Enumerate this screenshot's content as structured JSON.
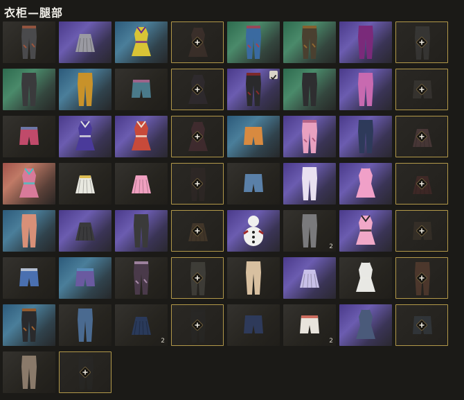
{
  "title": "衣柜—腿部",
  "slots": [
    {
      "bg": "dark",
      "kind": "pants",
      "color": "#4a4a4c",
      "accent": "#b0583a"
    },
    {
      "bg": "purple",
      "kind": "skirt",
      "color": "#9a9aa2"
    },
    {
      "bg": "blue",
      "kind": "outfit",
      "color": "#d8c436",
      "accent": "#6a2a8a"
    },
    {
      "bg": "locked",
      "kind": "outfit",
      "color": "#5a3a30",
      "locked": true
    },
    {
      "bg": "green",
      "kind": "pants",
      "color": "#3a6aa0",
      "accent": "#c03a3a"
    },
    {
      "bg": "green",
      "kind": "pants",
      "color": "#4a4030",
      "accent": "#a07030"
    },
    {
      "bg": "purple",
      "kind": "pants",
      "color": "#7a2a7a"
    },
    {
      "bg": "locked",
      "kind": "pants",
      "color": "#4a4a4a",
      "locked": true
    },
    {
      "bg": "green",
      "kind": "pants",
      "color": "#3a3a3c"
    },
    {
      "bg": "blue",
      "kind": "pants",
      "color": "#c8922a"
    },
    {
      "bg": "dark",
      "kind": "shorts",
      "color": "#4a7a8a",
      "accent": "#c05a8a"
    },
    {
      "bg": "locked",
      "kind": "outfit",
      "color": "#3a3040",
      "locked": true
    },
    {
      "bg": "purple",
      "kind": "pants",
      "color": "#2a2a2c",
      "accent": "#a02a2a",
      "checked": true
    },
    {
      "bg": "green",
      "kind": "pants",
      "color": "#2e2e30"
    },
    {
      "bg": "purple",
      "kind": "pants",
      "color": "#c86ab0"
    },
    {
      "bg": "locked",
      "kind": "shorts",
      "color": "#4a4440",
      "locked": true
    },
    {
      "bg": "dark",
      "kind": "shorts",
      "color": "#c04a6a",
      "accent": "#4a8ac0"
    },
    {
      "bg": "purple",
      "kind": "outfit",
      "color": "#4a3a9a",
      "accent": "#e0e0e0"
    },
    {
      "bg": "purple",
      "kind": "outfit",
      "color": "#c84a3a",
      "accent": "#f0e0d0"
    },
    {
      "bg": "locked",
      "kind": "outfit",
      "color": "#6a3040",
      "locked": true
    },
    {
      "bg": "blue",
      "kind": "shorts",
      "color": "#d88a40"
    },
    {
      "bg": "purple",
      "kind": "pants",
      "color": "#e8a0c0",
      "accent": "#a04a70"
    },
    {
      "bg": "purple",
      "kind": "pants",
      "color": "#2e3a5a"
    },
    {
      "bg": "locked",
      "kind": "skirt",
      "color": "#7a4a50",
      "locked": true
    },
    {
      "bg": "red",
      "kind": "outfit",
      "color": "#d87a9a",
      "accent": "#4ac0c0"
    },
    {
      "bg": "dark",
      "kind": "skirt",
      "color": "#e8e8e0",
      "accent": "#d8b030"
    },
    {
      "bg": "dark",
      "kind": "skirt",
      "color": "#f0a0c0"
    },
    {
      "bg": "locked",
      "kind": "pants",
      "color": "#3a2a2a",
      "locked": true
    },
    {
      "bg": "dark",
      "kind": "shorts",
      "color": "#5a80a8"
    },
    {
      "bg": "purple",
      "kind": "pants",
      "color": "#e8e0f0"
    },
    {
      "bg": "purple",
      "kind": "outfit",
      "color": "#f0a0c8"
    },
    {
      "bg": "locked",
      "kind": "skirt",
      "color": "#6a2a2a",
      "locked": true
    },
    {
      "bg": "blue",
      "kind": "pants",
      "color": "#d89078"
    },
    {
      "bg": "purple",
      "kind": "skirt",
      "color": "#3a3a3c"
    },
    {
      "bg": "purple",
      "kind": "pants",
      "color": "#3a3a3a"
    },
    {
      "bg": "locked",
      "kind": "skirt",
      "color": "#6a4a2a",
      "locked": true
    },
    {
      "bg": "purple",
      "kind": "snowman",
      "color": "#f0f0ee",
      "accent": "#a02a2a"
    },
    {
      "bg": "dark",
      "kind": "pants",
      "color": "#7a7a7c",
      "count": "2"
    },
    {
      "bg": "purple",
      "kind": "outfit",
      "color": "#f0a8c8",
      "accent": "#2a2a2a"
    },
    {
      "bg": "locked",
      "kind": "shorts",
      "color": "#4a3a2a",
      "locked": true
    },
    {
      "bg": "dark",
      "kind": "shorts",
      "color": "#4a70b0",
      "accent": "#e0e0e0"
    },
    {
      "bg": "blue",
      "kind": "shorts",
      "color": "#6a5aa0",
      "accent": "#50a0c0"
    },
    {
      "bg": "dark",
      "kind": "pants",
      "color": "#4a3a4a",
      "accent": "#c0a0c0"
    },
    {
      "bg": "locked",
      "kind": "pants",
      "color": "#5a5a50",
      "locked": true
    },
    {
      "bg": "dark",
      "kind": "pants",
      "color": "#d8c0a0"
    },
    {
      "bg": "purple",
      "kind": "skirt",
      "color": "#c8c0e8"
    },
    {
      "bg": "dark",
      "kind": "outfit",
      "color": "#e8e8e4"
    },
    {
      "bg": "locked",
      "kind": "pants",
      "color": "#8a4a30",
      "locked": true
    },
    {
      "bg": "blue",
      "kind": "pants",
      "color": "#2a2a2c",
      "accent": "#c07030"
    },
    {
      "bg": "dark",
      "kind": "pants",
      "color": "#4a6a90"
    },
    {
      "bg": "dark",
      "kind": "skirt",
      "color": "#2a3a5a",
      "count": "2"
    },
    {
      "bg": "locked",
      "kind": "pants",
      "color": "#2a2a2a",
      "locked": true
    },
    {
      "bg": "dark",
      "kind": "shorts",
      "color": "#2e3a5a"
    },
    {
      "bg": "dark",
      "kind": "shorts",
      "color": "#e8e4dc",
      "accent": "#c03a2a",
      "count": "2"
    },
    {
      "bg": "purple",
      "kind": "outfit",
      "color": "#4a5a7a"
    },
    {
      "bg": "locked",
      "kind": "shorts",
      "color": "#3a4a5a",
      "locked": true
    },
    {
      "bg": "dark",
      "kind": "pants",
      "color": "#8a7a6a"
    },
    {
      "bg": "locked",
      "kind": "pants",
      "color": "#2a2a2a",
      "locked": true
    }
  ]
}
